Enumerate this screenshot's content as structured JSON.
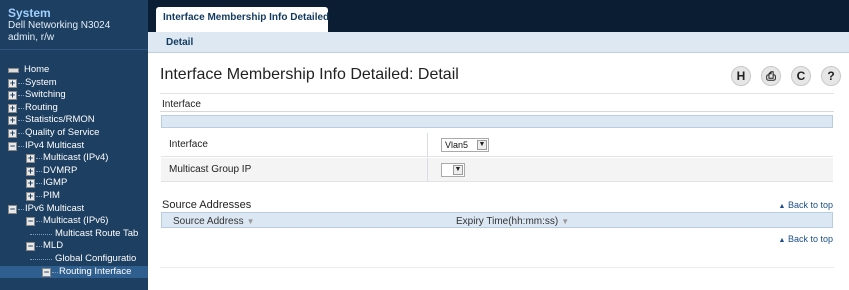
{
  "system": {
    "title": "System",
    "device": "Dell Networking N3024",
    "user": "admin, r/w"
  },
  "nav": {
    "items": [
      {
        "label": "Home",
        "level": 0,
        "icon": "home"
      },
      {
        "label": "System",
        "level": 0,
        "icon": "plus"
      },
      {
        "label": "Switching",
        "level": 0,
        "icon": "plus"
      },
      {
        "label": "Routing",
        "level": 0,
        "icon": "plus"
      },
      {
        "label": "Statistics/RMON",
        "level": 0,
        "icon": "plus"
      },
      {
        "label": "Quality of Service",
        "level": 0,
        "icon": "plus"
      },
      {
        "label": "IPv4 Multicast",
        "level": 0,
        "icon": "minus"
      },
      {
        "label": "Multicast (IPv4)",
        "level": 1,
        "icon": "plus"
      },
      {
        "label": "DVMRP",
        "level": 1,
        "icon": "plus"
      },
      {
        "label": "IGMP",
        "level": 1,
        "icon": "plus"
      },
      {
        "label": "PIM",
        "level": 1,
        "icon": "plus"
      },
      {
        "label": "IPv6 Multicast",
        "level": 0,
        "icon": "minus"
      },
      {
        "label": "Multicast (IPv6)",
        "level": 1,
        "icon": "minus"
      },
      {
        "label": "Multicast Route Tab",
        "level": 2,
        "icon": "none"
      },
      {
        "label": "MLD",
        "level": 1,
        "icon": "minus"
      },
      {
        "label": "Global Configuratio",
        "level": 2,
        "icon": "none"
      },
      {
        "label": "Routing Interface",
        "level": 2,
        "icon": "minus"
      }
    ]
  },
  "tabs": {
    "active": "Interface Membership Info Detailed",
    "subtab": "Detail"
  },
  "page": {
    "title": "Interface Membership Info Detailed: Detail",
    "tools": [
      {
        "name": "help-icon",
        "glyph": "H"
      },
      {
        "name": "print-icon",
        "glyph": "⎙"
      },
      {
        "name": "refresh-icon",
        "glyph": "C"
      },
      {
        "name": "question-icon",
        "glyph": "?"
      }
    ]
  },
  "interface_section": {
    "title": "Interface",
    "rows": [
      {
        "label": "Interface",
        "value": "Vlan5"
      },
      {
        "label": "Multicast Group IP",
        "value": ""
      }
    ]
  },
  "source_section": {
    "title": "Source Addresses",
    "back_to_top": "Back to top",
    "columns": [
      "Source Address",
      "Expiry Time(hh:mm:ss)"
    ],
    "back_to_top_bottom": "Back to top"
  },
  "colors": {
    "sidebar": "#1d3f61",
    "topbar": "#0b1d33",
    "accent": "#1a4f8c",
    "table_header": "#dbe7f3"
  }
}
